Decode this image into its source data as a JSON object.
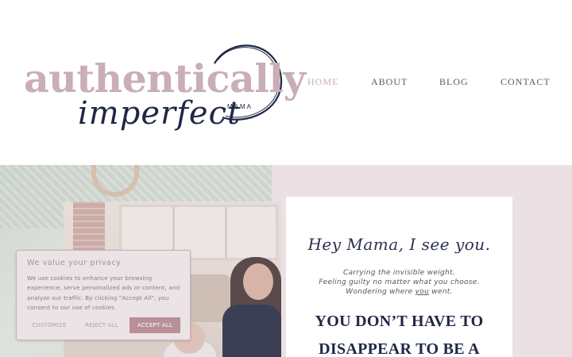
{
  "brand": {
    "name_main": "authentically",
    "name_script": "imperfect",
    "tag": "MAMA",
    "colors": {
      "pink": "#c9aeb6",
      "navy": "#1f2746"
    }
  },
  "nav": {
    "items": [
      {
        "label": "HOME",
        "active": true
      },
      {
        "label": "ABOUT",
        "active": false
      },
      {
        "label": "BLOG",
        "active": false
      },
      {
        "label": "CONTACT",
        "active": false
      }
    ]
  },
  "hero": {
    "greeting": "Hey Mama, I see you.",
    "lines": [
      "Carrying the invisible weight.",
      "Feeling guilty no matter what you choose.",
      "Wondering where you went."
    ],
    "underlined_word": "you",
    "line3_prefix": "Wondering where ",
    "line3_suffix": " went.",
    "headline_1": "YOU DON’T HAVE TO",
    "headline_2": "DISAPPEAR TO BE A"
  },
  "cookie": {
    "title": "We value your privacy",
    "body": "We use cookies to enhance your browsing experience, serve personalized ads or content, and analyze our traffic. By clicking \"Accept All\", you consent to our use of cookies.",
    "customize_label": "CUSTOMIZE",
    "reject_label": "REJECT ALL",
    "accept_label": "ACCEPT ALL",
    "accent_color": "#b98f98"
  }
}
